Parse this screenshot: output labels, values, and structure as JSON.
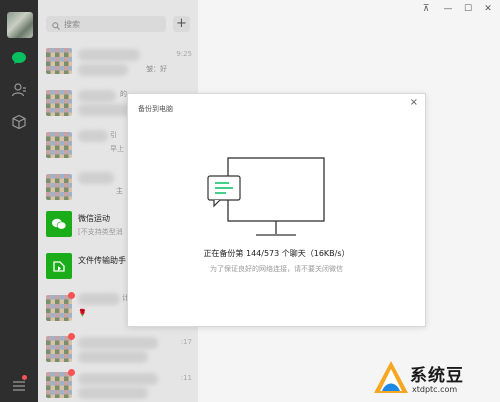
{
  "sidebar": {
    "icons": [
      "chat-icon",
      "contacts-icon",
      "favorites-cube-icon",
      "menu-icon"
    ],
    "accent": "#07c160"
  },
  "chat_list": {
    "search_placeholder": "搜索",
    "add_label": "+",
    "items": [
      {
        "name": "",
        "preview": "",
        "time": "9:25",
        "snippet": "皱：好"
      },
      {
        "name": "",
        "preview": "",
        "time": "",
        "snippet": "的"
      },
      {
        "name": "",
        "preview": "早上",
        "time": "",
        "snippet": "引"
      },
      {
        "name": "",
        "preview": "",
        "time": "",
        "snippet": "主"
      },
      {
        "name": "微信运动",
        "preview": "[不支持类型消",
        "time": ""
      },
      {
        "name": "文件传输助手",
        "preview": "",
        "time": ""
      },
      {
        "name": "",
        "preview": "",
        "time": "",
        "snippet": "计"
      },
      {
        "name": "",
        "preview": "",
        "time": ":17",
        "snippet": ""
      },
      {
        "name": "",
        "preview": "",
        "time": ":11",
        "snippet": ""
      }
    ]
  },
  "window_controls": {
    "pin": "⊼",
    "minimize": "—",
    "maximize": "☐",
    "close": "✕"
  },
  "dialog": {
    "title": "备份到电脑",
    "close_label": "×",
    "status": "正在备份第 144/573 个聊天（16KB/s）",
    "hint": "为了保证良好的网络连接，请不要关闭微信",
    "accent": "#07c160"
  },
  "watermark": {
    "brand": "系统豆",
    "url": "xtdptc.com"
  }
}
